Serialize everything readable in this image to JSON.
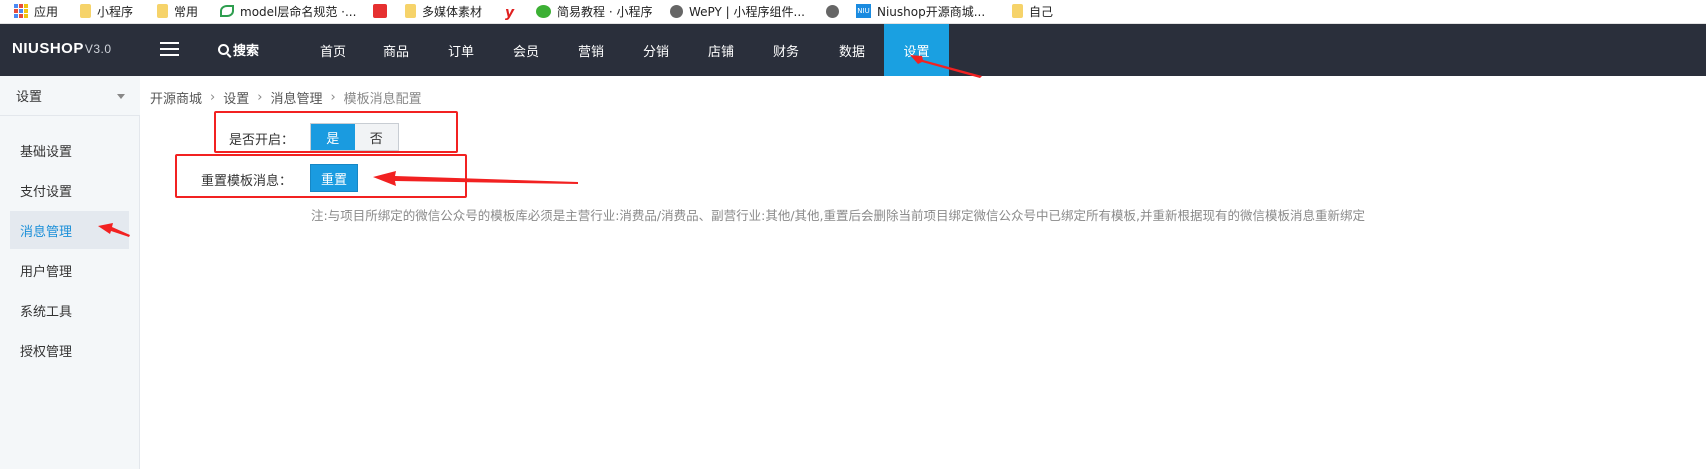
{
  "bookmarks": [
    {
      "label": "应用",
      "icon": "apps-icon"
    },
    {
      "label": "小程序",
      "icon": "folder-icon"
    },
    {
      "label": "常用",
      "icon": "folder-icon"
    },
    {
      "label": "model层命名规范 ·...",
      "icon": "leaf-icon"
    },
    {
      "label": "",
      "icon": "red-square-icon"
    },
    {
      "label": "多媒体素材",
      "icon": "folder-icon"
    },
    {
      "label": "",
      "icon": "y-icon"
    },
    {
      "label": "简易教程 · 小程序",
      "icon": "wechat-icon"
    },
    {
      "label": "WePY | 小程序组件...",
      "icon": "globe-icon"
    },
    {
      "label": "",
      "icon": "globe-icon"
    },
    {
      "label": "Niushop开源商城...",
      "icon": "niushop-icon"
    },
    {
      "label": "自己",
      "icon": "folder-icon"
    }
  ],
  "header": {
    "logo_main": "NIUSHOP",
    "logo_version": "V3.0",
    "search_label": "搜索",
    "nav": [
      "首页",
      "商品",
      "订单",
      "会员",
      "营销",
      "分销",
      "店铺",
      "财务",
      "数据",
      "设置"
    ],
    "active_nav": "设置"
  },
  "sidebar": {
    "select_value": "设置",
    "items": [
      "基础设置",
      "支付设置",
      "消息管理",
      "用户管理",
      "系统工具",
      "授权管理"
    ],
    "active_item": "消息管理"
  },
  "breadcrumb": [
    "开源商城",
    "设置",
    "消息管理",
    "模板消息配置"
  ],
  "form": {
    "enable_label": "是否开启：",
    "enable_options": [
      "是",
      "否"
    ],
    "enable_selected": "是",
    "reset_label": "重置模板消息：",
    "reset_button": "重置",
    "note": "注:与项目所绑定的微信公众号的模板库必须是主营行业:消费品/消费品、副营行业:其他/其他,重置后会删除当前项目绑定微信公众号中已绑定所有模板,并重新根据现有的微信模板消息重新绑定"
  },
  "colors": {
    "nav_bg": "#2a2f3b",
    "accent": "#1a9be0",
    "annotation": "#f22121"
  }
}
